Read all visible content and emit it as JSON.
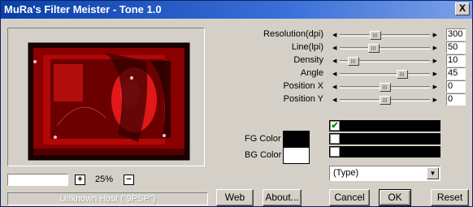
{
  "window": {
    "title": "MuRa's Filter Meister - Tone 1.0",
    "close_label": "X"
  },
  "preview": {
    "zoom_level": "25%",
    "zoom_in": "+",
    "zoom_out": "−"
  },
  "status": {
    "text": "Unknown Host (\"9PSP\")"
  },
  "sliders": [
    {
      "label": "Resolution(dpi)",
      "value": "300",
      "position": 0.38
    },
    {
      "label": "Line(lpi)",
      "value": "50",
      "position": 0.36
    },
    {
      "label": "Density",
      "value": "10",
      "position": 0.1
    },
    {
      "label": "Angle",
      "value": "45",
      "position": 0.72
    },
    {
      "label": "Position X",
      "value": "0",
      "position": 0.5
    },
    {
      "label": "Position Y",
      "value": "0",
      "position": 0.5
    }
  ],
  "colors": {
    "fg_label": "FG Color",
    "fg_value": "#000000",
    "bg_label": "BG Color",
    "bg_value": "#ffffff"
  },
  "checkboxes": [
    {
      "checked": true,
      "mark": "✔"
    },
    {
      "checked": false,
      "mark": ""
    },
    {
      "checked": false,
      "mark": ""
    }
  ],
  "type_select": {
    "value": "(Type)"
  },
  "buttons": {
    "web": "Web",
    "about": "About...",
    "cancel": "Cancel",
    "ok": "OK",
    "reset": "Reset"
  }
}
